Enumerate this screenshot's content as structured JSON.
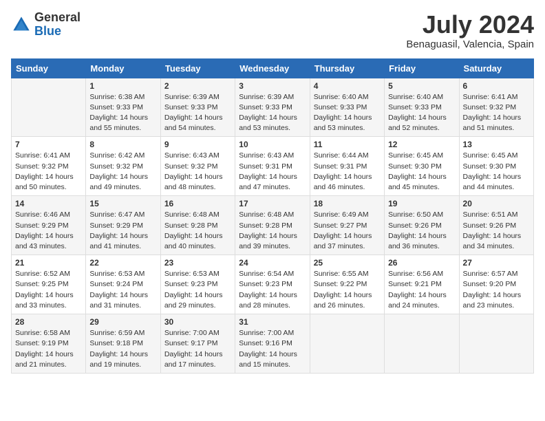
{
  "logo": {
    "general": "General",
    "blue": "Blue"
  },
  "title": {
    "month_year": "July 2024",
    "location": "Benaguasil, Valencia, Spain"
  },
  "days_of_week": [
    "Sunday",
    "Monday",
    "Tuesday",
    "Wednesday",
    "Thursday",
    "Friday",
    "Saturday"
  ],
  "weeks": [
    [
      {
        "day": "",
        "sunrise": "",
        "sunset": "",
        "daylight": ""
      },
      {
        "day": "1",
        "sunrise": "Sunrise: 6:38 AM",
        "sunset": "Sunset: 9:33 PM",
        "daylight": "Daylight: 14 hours and 55 minutes."
      },
      {
        "day": "2",
        "sunrise": "Sunrise: 6:39 AM",
        "sunset": "Sunset: 9:33 PM",
        "daylight": "Daylight: 14 hours and 54 minutes."
      },
      {
        "day": "3",
        "sunrise": "Sunrise: 6:39 AM",
        "sunset": "Sunset: 9:33 PM",
        "daylight": "Daylight: 14 hours and 53 minutes."
      },
      {
        "day": "4",
        "sunrise": "Sunrise: 6:40 AM",
        "sunset": "Sunset: 9:33 PM",
        "daylight": "Daylight: 14 hours and 53 minutes."
      },
      {
        "day": "5",
        "sunrise": "Sunrise: 6:40 AM",
        "sunset": "Sunset: 9:33 PM",
        "daylight": "Daylight: 14 hours and 52 minutes."
      },
      {
        "day": "6",
        "sunrise": "Sunrise: 6:41 AM",
        "sunset": "Sunset: 9:32 PM",
        "daylight": "Daylight: 14 hours and 51 minutes."
      }
    ],
    [
      {
        "day": "7",
        "sunrise": "Sunrise: 6:41 AM",
        "sunset": "Sunset: 9:32 PM",
        "daylight": "Daylight: 14 hours and 50 minutes."
      },
      {
        "day": "8",
        "sunrise": "Sunrise: 6:42 AM",
        "sunset": "Sunset: 9:32 PM",
        "daylight": "Daylight: 14 hours and 49 minutes."
      },
      {
        "day": "9",
        "sunrise": "Sunrise: 6:43 AM",
        "sunset": "Sunset: 9:32 PM",
        "daylight": "Daylight: 14 hours and 48 minutes."
      },
      {
        "day": "10",
        "sunrise": "Sunrise: 6:43 AM",
        "sunset": "Sunset: 9:31 PM",
        "daylight": "Daylight: 14 hours and 47 minutes."
      },
      {
        "day": "11",
        "sunrise": "Sunrise: 6:44 AM",
        "sunset": "Sunset: 9:31 PM",
        "daylight": "Daylight: 14 hours and 46 minutes."
      },
      {
        "day": "12",
        "sunrise": "Sunrise: 6:45 AM",
        "sunset": "Sunset: 9:30 PM",
        "daylight": "Daylight: 14 hours and 45 minutes."
      },
      {
        "day": "13",
        "sunrise": "Sunrise: 6:45 AM",
        "sunset": "Sunset: 9:30 PM",
        "daylight": "Daylight: 14 hours and 44 minutes."
      }
    ],
    [
      {
        "day": "14",
        "sunrise": "Sunrise: 6:46 AM",
        "sunset": "Sunset: 9:29 PM",
        "daylight": "Daylight: 14 hours and 43 minutes."
      },
      {
        "day": "15",
        "sunrise": "Sunrise: 6:47 AM",
        "sunset": "Sunset: 9:29 PM",
        "daylight": "Daylight: 14 hours and 41 minutes."
      },
      {
        "day": "16",
        "sunrise": "Sunrise: 6:48 AM",
        "sunset": "Sunset: 9:28 PM",
        "daylight": "Daylight: 14 hours and 40 minutes."
      },
      {
        "day": "17",
        "sunrise": "Sunrise: 6:48 AM",
        "sunset": "Sunset: 9:28 PM",
        "daylight": "Daylight: 14 hours and 39 minutes."
      },
      {
        "day": "18",
        "sunrise": "Sunrise: 6:49 AM",
        "sunset": "Sunset: 9:27 PM",
        "daylight": "Daylight: 14 hours and 37 minutes."
      },
      {
        "day": "19",
        "sunrise": "Sunrise: 6:50 AM",
        "sunset": "Sunset: 9:26 PM",
        "daylight": "Daylight: 14 hours and 36 minutes."
      },
      {
        "day": "20",
        "sunrise": "Sunrise: 6:51 AM",
        "sunset": "Sunset: 9:26 PM",
        "daylight": "Daylight: 14 hours and 34 minutes."
      }
    ],
    [
      {
        "day": "21",
        "sunrise": "Sunrise: 6:52 AM",
        "sunset": "Sunset: 9:25 PM",
        "daylight": "Daylight: 14 hours and 33 minutes."
      },
      {
        "day": "22",
        "sunrise": "Sunrise: 6:53 AM",
        "sunset": "Sunset: 9:24 PM",
        "daylight": "Daylight: 14 hours and 31 minutes."
      },
      {
        "day": "23",
        "sunrise": "Sunrise: 6:53 AM",
        "sunset": "Sunset: 9:23 PM",
        "daylight": "Daylight: 14 hours and 29 minutes."
      },
      {
        "day": "24",
        "sunrise": "Sunrise: 6:54 AM",
        "sunset": "Sunset: 9:23 PM",
        "daylight": "Daylight: 14 hours and 28 minutes."
      },
      {
        "day": "25",
        "sunrise": "Sunrise: 6:55 AM",
        "sunset": "Sunset: 9:22 PM",
        "daylight": "Daylight: 14 hours and 26 minutes."
      },
      {
        "day": "26",
        "sunrise": "Sunrise: 6:56 AM",
        "sunset": "Sunset: 9:21 PM",
        "daylight": "Daylight: 14 hours and 24 minutes."
      },
      {
        "day": "27",
        "sunrise": "Sunrise: 6:57 AM",
        "sunset": "Sunset: 9:20 PM",
        "daylight": "Daylight: 14 hours and 23 minutes."
      }
    ],
    [
      {
        "day": "28",
        "sunrise": "Sunrise: 6:58 AM",
        "sunset": "Sunset: 9:19 PM",
        "daylight": "Daylight: 14 hours and 21 minutes."
      },
      {
        "day": "29",
        "sunrise": "Sunrise: 6:59 AM",
        "sunset": "Sunset: 9:18 PM",
        "daylight": "Daylight: 14 hours and 19 minutes."
      },
      {
        "day": "30",
        "sunrise": "Sunrise: 7:00 AM",
        "sunset": "Sunset: 9:17 PM",
        "daylight": "Daylight: 14 hours and 17 minutes."
      },
      {
        "day": "31",
        "sunrise": "Sunrise: 7:00 AM",
        "sunset": "Sunset: 9:16 PM",
        "daylight": "Daylight: 14 hours and 15 minutes."
      },
      {
        "day": "",
        "sunrise": "",
        "sunset": "",
        "daylight": ""
      },
      {
        "day": "",
        "sunrise": "",
        "sunset": "",
        "daylight": ""
      },
      {
        "day": "",
        "sunrise": "",
        "sunset": "",
        "daylight": ""
      }
    ]
  ]
}
